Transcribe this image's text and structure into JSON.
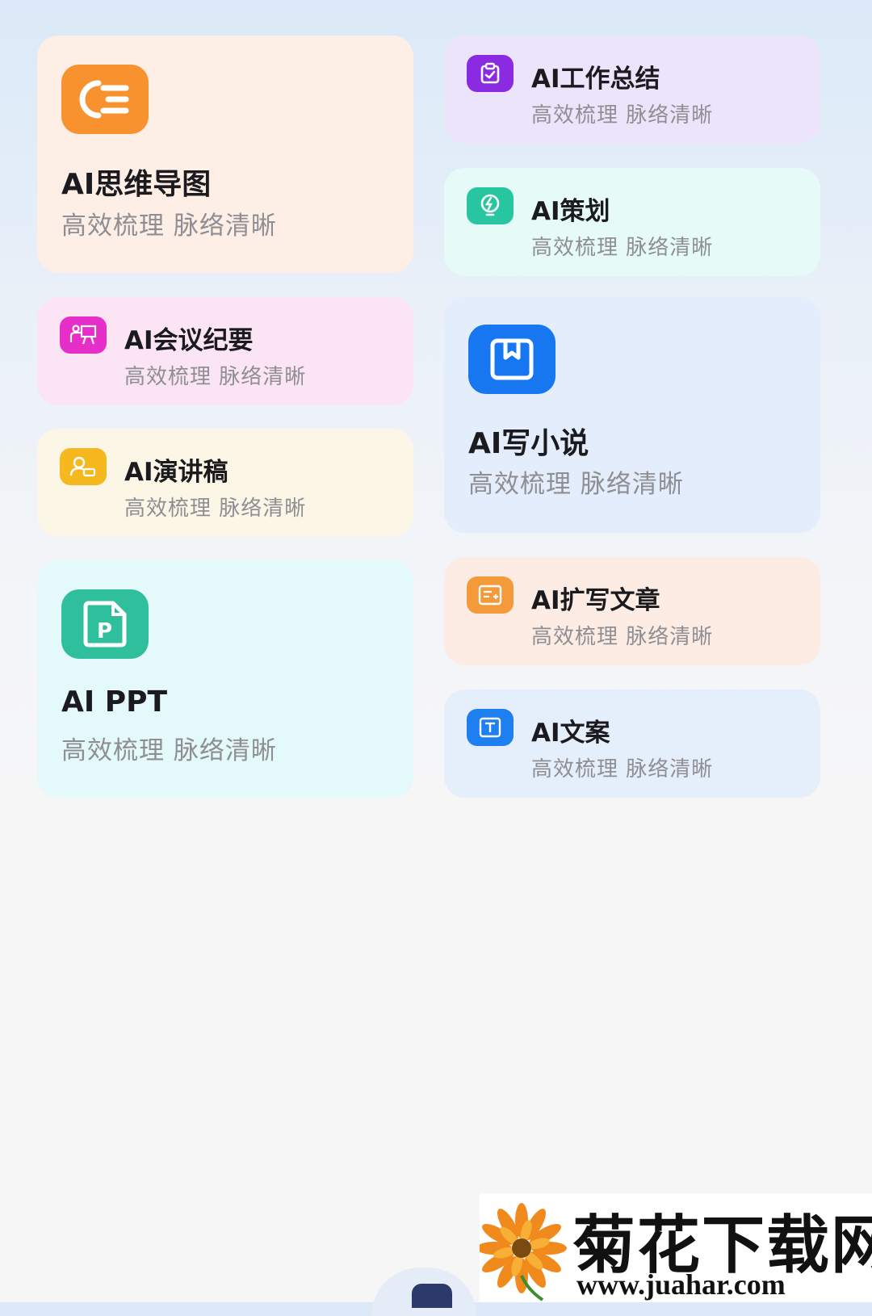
{
  "cards": {
    "mindmap": {
      "title": "AI思维导图",
      "subtitle": "高效梳理 脉络清晰",
      "icon": "mindmap-icon",
      "color": "#f7922e"
    },
    "work_summary": {
      "title": "AI工作总结",
      "subtitle": "高效梳理 脉络清晰",
      "icon": "clipboard-check-icon",
      "color": "#8a2be2"
    },
    "planning": {
      "title": "AI策划",
      "subtitle": "高效梳理 脉络清晰",
      "icon": "lightbulb-icon",
      "color": "#28c6a0"
    },
    "meeting": {
      "title": "AI会议纪要",
      "subtitle": "高效梳理 脉络清晰",
      "icon": "presentation-icon",
      "color": "#e62fc9"
    },
    "novel": {
      "title": "AI写小说",
      "subtitle": "高效梳理 脉络清晰",
      "icon": "book-icon",
      "color": "#1677f0"
    },
    "speech": {
      "title": "AI演讲稿",
      "subtitle": "高效梳理 脉络清晰",
      "icon": "speaker-icon",
      "color": "#f5b81f"
    },
    "ppt": {
      "title": "AI PPT",
      "subtitle": "高效梳理 脉络清晰",
      "icon": "ppt-file-icon",
      "color": "#2fbf9c"
    },
    "expand": {
      "title": "AI扩写文章",
      "subtitle": "高效梳理 脉络清晰",
      "icon": "text-expand-icon",
      "color": "#f59a3b"
    },
    "copywriting": {
      "title": "AI文案",
      "subtitle": "高效梳理 脉络清晰",
      "icon": "text-box-icon",
      "color": "#1e7ff0"
    }
  },
  "watermark": {
    "title": "菊花下载网",
    "url": "www.juahar.com"
  }
}
